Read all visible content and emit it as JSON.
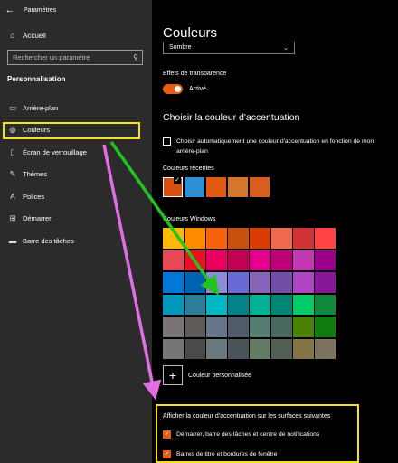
{
  "window": {
    "title": "Paramètres",
    "back_icon": "back-arrow-icon"
  },
  "sidebar": {
    "home": {
      "label": "Accueil",
      "icon": "home-icon"
    },
    "search": {
      "placeholder": "Rechercher un paramètre",
      "icon": "search-icon"
    },
    "section_title": "Personnalisation",
    "items": [
      {
        "label": "Arrière-plan",
        "icon": "picture-icon"
      },
      {
        "label": "Couleurs",
        "icon": "palette-icon",
        "active": true
      },
      {
        "label": "Écran de verrouillage",
        "icon": "lock-screen-icon"
      },
      {
        "label": "Thèmes",
        "icon": "brush-icon"
      },
      {
        "label": "Polices",
        "icon": "font-icon"
      },
      {
        "label": "Démarrer",
        "icon": "start-icon"
      },
      {
        "label": "Barre des tâches",
        "icon": "taskbar-icon"
      }
    ]
  },
  "main": {
    "title": "Couleurs",
    "mode_select": {
      "value": "Sombre"
    },
    "transparency": {
      "label": "Effets de transparence",
      "state": "Activé",
      "on": true
    },
    "accent_heading": "Choisir la couleur d'accentuation",
    "auto_accent": {
      "label": "Choisir automatiquement une couleur d'accentuation en fonction de mon arrière-plan",
      "checked": false
    },
    "recent_label": "Couleurs récentes",
    "recent_colors": [
      "#d94f10",
      "#2d8fd4",
      "#e05a14",
      "#d4762c",
      "#d85e20"
    ],
    "windows_label": "Couleurs Windows",
    "windows_colors": [
      "#ffb900",
      "#ff8c00",
      "#f7630c",
      "#ca5010",
      "#da3b01",
      "#ef6950",
      "#d13438",
      "#ff4343",
      "#e74856",
      "#e81123",
      "#ea005e",
      "#c30052",
      "#e3008c",
      "#bf0077",
      "#c239b3",
      "#9a0089",
      "#0078d7",
      "#0063b1",
      "#8e8cd8",
      "#6b69d6",
      "#8764b8",
      "#744da9",
      "#b146c2",
      "#881798",
      "#0099bc",
      "#2d7d9a",
      "#00b7c3",
      "#038387",
      "#00b294",
      "#018574",
      "#00cc6a",
      "#10893e",
      "#7a7574",
      "#5d5a58",
      "#68768a",
      "#515c6b",
      "#567c73",
      "#486860",
      "#498205",
      "#107c10",
      "#767676",
      "#4c4a48",
      "#69797e",
      "#4a5459",
      "#647c64",
      "#525e54",
      "#847545",
      "#7e735f"
    ],
    "custom_color_label": "Couleur personnalisée",
    "surfaces_label": "Afficher la couleur d'accentuation sur les surfaces suivantes",
    "surfaces": [
      {
        "label": "Démarrer, barre des tâches et centre de notifications",
        "checked": true
      },
      {
        "label": "Barres de titre et bordures de fenêtre",
        "checked": true
      }
    ]
  },
  "annotation_colors": {
    "highlight": "#f5e21a",
    "green_arrow": "#22c21f",
    "pink_arrow": "#e070e0"
  }
}
